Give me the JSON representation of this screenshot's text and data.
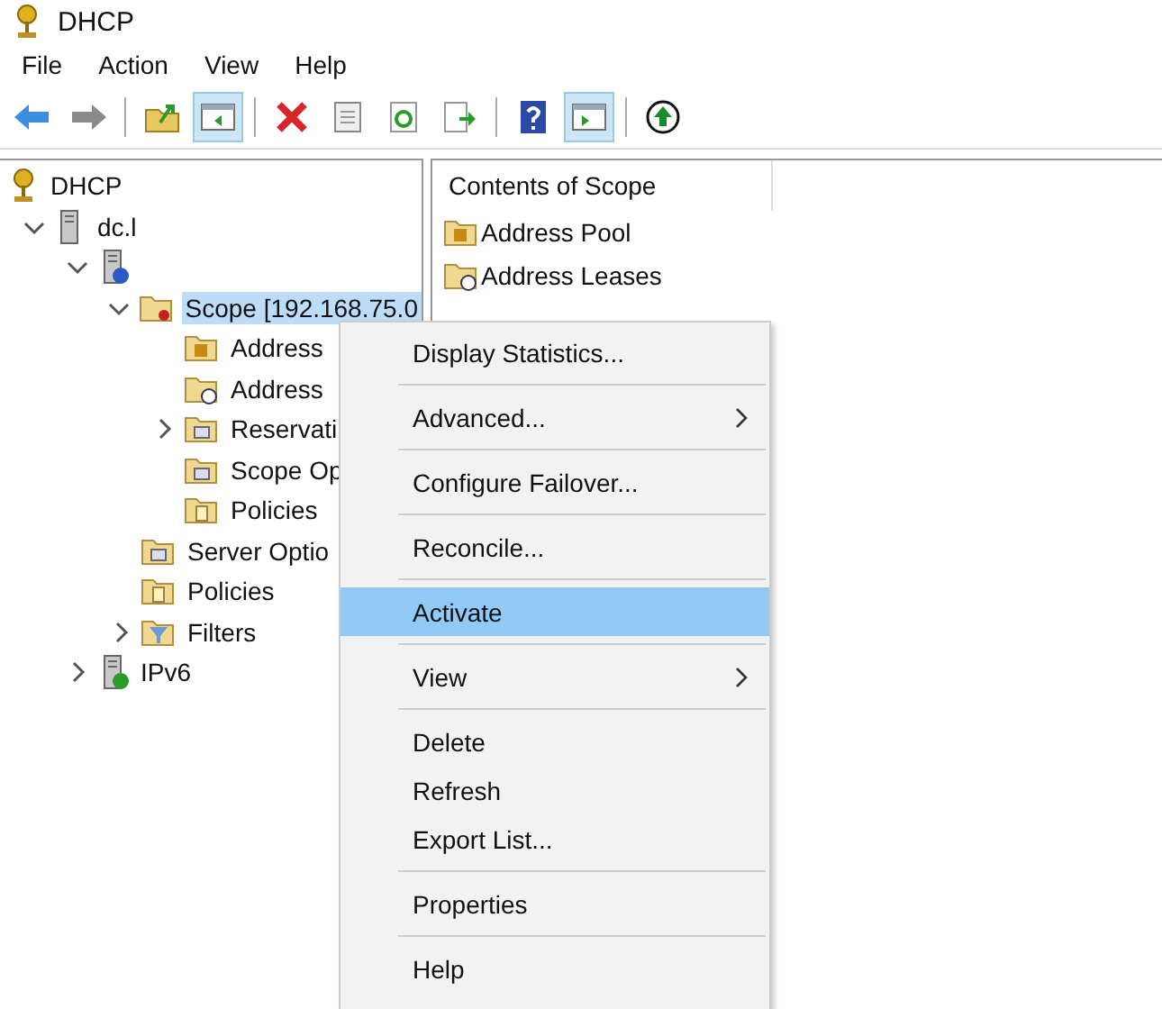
{
  "window": {
    "title": "DHCP"
  },
  "menu_bar": [
    "File",
    "Action",
    "View",
    "Help"
  ],
  "toolbar": [
    {
      "kind": "back",
      "pressed": false
    },
    {
      "kind": "forward",
      "pressed": false
    },
    {
      "kind": "separator"
    },
    {
      "kind": "up",
      "pressed": false
    },
    {
      "kind": "tree",
      "pressed": true
    },
    {
      "kind": "separator"
    },
    {
      "kind": "delete",
      "pressed": false
    },
    {
      "kind": "properties",
      "pressed": false
    },
    {
      "kind": "refresh",
      "pressed": false
    },
    {
      "kind": "export",
      "pressed": false
    },
    {
      "kind": "separator"
    },
    {
      "kind": "help",
      "pressed": false
    },
    {
      "kind": "pane",
      "pressed": true
    },
    {
      "kind": "separator"
    },
    {
      "kind": "activate",
      "pressed": false
    }
  ],
  "tree": [
    {
      "label": "DHCP",
      "kind": "dhcp",
      "selected": false,
      "children": [
        {
          "label": "dc.l",
          "kind": "server",
          "expanded": true,
          "selected": false,
          "children": [
            {
              "kind": "ipv4",
              "expanded": true,
              "children": [
                {
                  "label": "Scope [192.168.75.0",
                  "kind": "scope",
                  "expanded": true,
                  "selected": true,
                  "children": [
                    {
                      "label": "Address",
                      "kind": "pool",
                      "selected": false
                    },
                    {
                      "label": "Address",
                      "kind": "leases",
                      "selected": false
                    },
                    {
                      "label": "Reservati",
                      "kind": "reservations",
                      "expanded": false,
                      "selected": false
                    },
                    {
                      "label": "Scope Op",
                      "kind": "options",
                      "selected": false
                    },
                    {
                      "label": "Policies",
                      "kind": "policies",
                      "selected": false
                    }
                  ]
                },
                {
                  "label": "Server Optio",
                  "kind": "options",
                  "selected": false
                },
                {
                  "label": "Policies",
                  "kind": "policies",
                  "selected": false
                },
                {
                  "label": "Filters",
                  "kind": "filter",
                  "expanded": false,
                  "selected": false
                }
              ]
            },
            {
              "label": "IPv6",
              "kind": "ipv6",
              "expanded": false,
              "selected": false
            }
          ]
        }
      ]
    }
  ],
  "contents": {
    "header": "Contents of Scope",
    "items": [
      {
        "label": "Address Pool",
        "kind": "pool"
      },
      {
        "label": "Address Leases",
        "kind": "leases"
      }
    ]
  },
  "context_menu": [
    {
      "kind": "item",
      "label": "Display Statistics...",
      "submenu": false,
      "selected": false
    },
    {
      "kind": "separator"
    },
    {
      "kind": "item",
      "label": "Advanced...",
      "submenu": true,
      "selected": false
    },
    {
      "kind": "separator"
    },
    {
      "kind": "item",
      "label": "Configure Failover...",
      "submenu": false,
      "selected": false
    },
    {
      "kind": "separator"
    },
    {
      "kind": "item",
      "label": "Reconcile...",
      "submenu": false,
      "selected": false
    },
    {
      "kind": "separator"
    },
    {
      "kind": "item",
      "label": "Activate",
      "submenu": false,
      "selected": true
    },
    {
      "kind": "separator"
    },
    {
      "kind": "item",
      "label": "View",
      "submenu": true,
      "selected": false
    },
    {
      "kind": "separator"
    },
    {
      "kind": "item",
      "label": "Delete",
      "submenu": false,
      "selected": false
    },
    {
      "kind": "item",
      "label": "Refresh",
      "submenu": false,
      "selected": false
    },
    {
      "kind": "item",
      "label": "Export List...",
      "submenu": false,
      "selected": false
    },
    {
      "kind": "separator"
    },
    {
      "kind": "item",
      "label": "Properties",
      "submenu": false,
      "selected": false
    },
    {
      "kind": "separator"
    },
    {
      "kind": "item",
      "label": "Help",
      "submenu": false,
      "selected": false
    }
  ]
}
